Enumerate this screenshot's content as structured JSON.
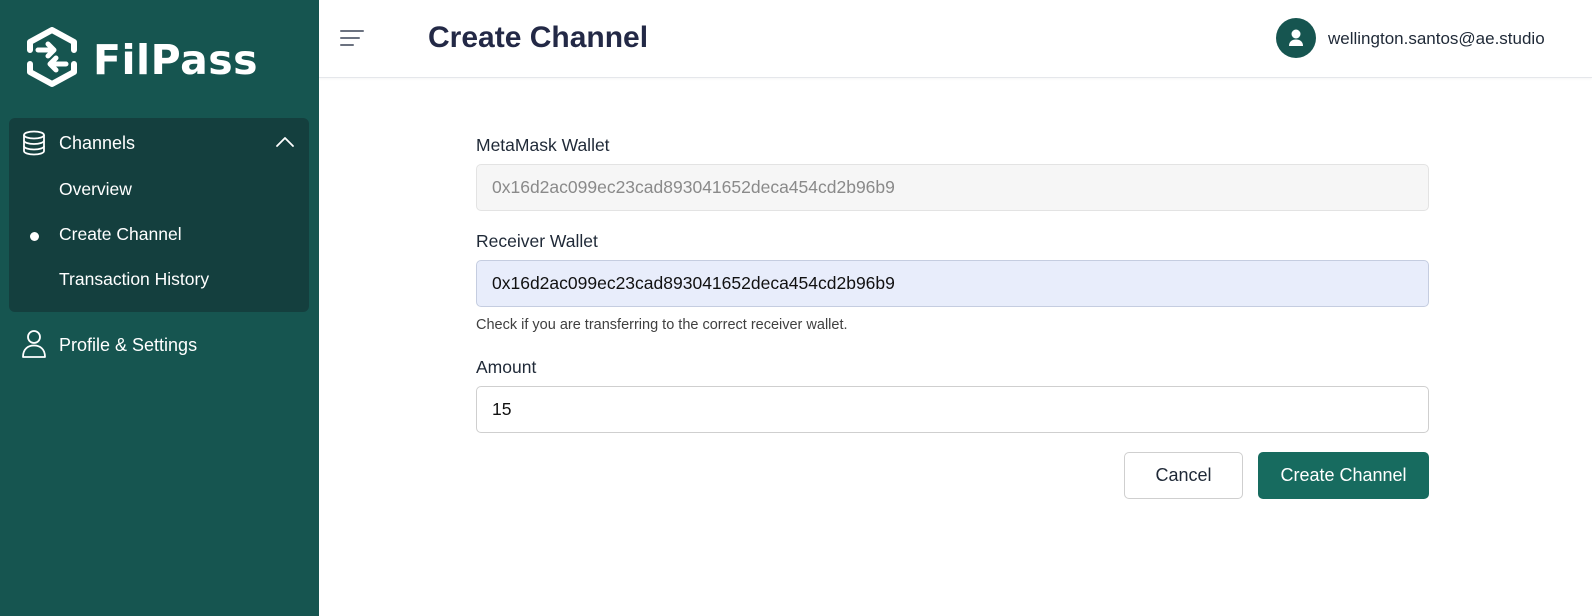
{
  "brand": {
    "name": "FilPass"
  },
  "sidebar": {
    "group": {
      "label": "Channels",
      "items": [
        {
          "label": "Overview"
        },
        {
          "label": "Create Channel",
          "active": true
        },
        {
          "label": "Transaction History"
        }
      ]
    },
    "profile": {
      "label": "Profile & Settings"
    }
  },
  "header": {
    "title": "Create Channel",
    "user_email": "wellington.santos@ae.studio"
  },
  "form": {
    "metamask": {
      "label": "MetaMask Wallet",
      "value": "0x16d2ac099ec23cad893041652deca454cd2b96b9"
    },
    "receiver": {
      "label": "Receiver Wallet",
      "value": "0x16d2ac099ec23cad893041652deca454cd2b96b9",
      "help": "Check if you are transferring to the correct receiver wallet."
    },
    "amount": {
      "label": "Amount",
      "value": "15"
    },
    "cancel_label": "Cancel",
    "submit_label": "Create Channel"
  },
  "colors": {
    "sidebar_bg": "#165550",
    "nav_group_bg": "#143f3e",
    "primary": "#176b5f",
    "title": "#232946"
  },
  "icons": [
    "filpass-logo-icon",
    "database-icon",
    "chevron-up-icon",
    "user-outline-icon",
    "menu-icon",
    "user-avatar-icon"
  ]
}
